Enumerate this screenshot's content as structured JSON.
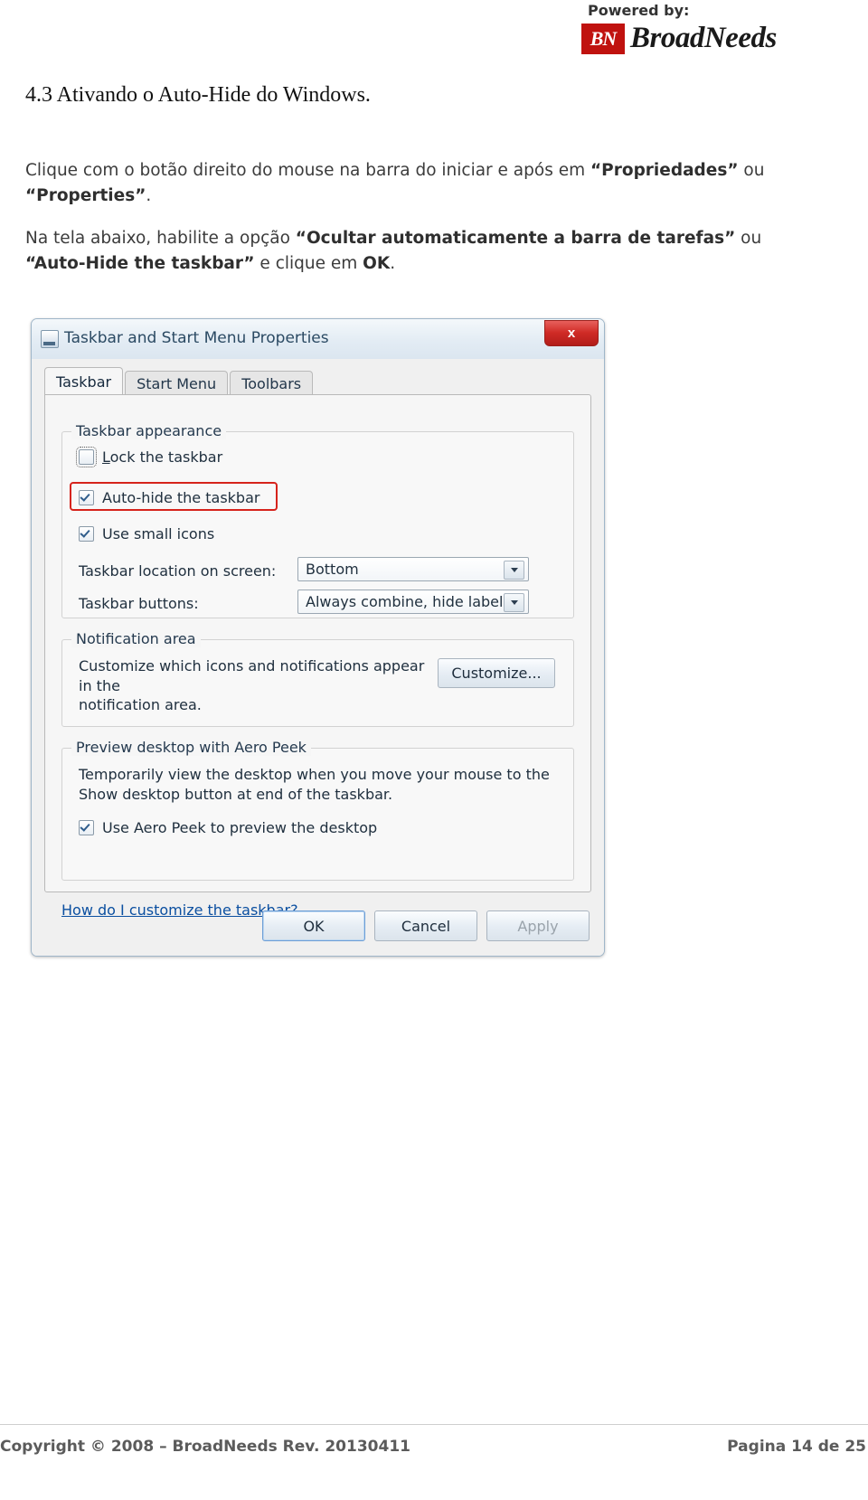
{
  "header": {
    "powered_by": "Powered by:",
    "logo_mark": "BN",
    "logo_text": "BroadNeeds"
  },
  "section": {
    "title": "4.3 Ativando o Auto-Hide do Windows."
  },
  "paragraphs": {
    "p1_a": "Clique com o botão direito do mouse na barra do iniciar e após em ",
    "p1_b": "“Propriedades”",
    "p1_c": " ou ",
    "p1_d": "“Properties”",
    "p1_e": ".",
    "p2_a": "Na tela abaixo, habilite a opção ",
    "p2_b": "“Ocultar automaticamente a barra de tarefas”",
    "p2_c": " ou ",
    "p2_d": "“Auto-Hide the taskbar”",
    "p2_e": " e clique em ",
    "p2_f": "OK",
    "p2_g": "."
  },
  "dialog": {
    "title": "Taskbar and Start Menu Properties",
    "close_label": "x",
    "tabs": [
      {
        "label": "Taskbar",
        "active": true
      },
      {
        "label": "Start Menu",
        "active": false
      },
      {
        "label": "Toolbars",
        "active": false
      }
    ],
    "taskbar_appearance": {
      "legend": "Taskbar appearance",
      "lock_taskbar": "Lock the taskbar",
      "auto_hide": "Auto-hide the taskbar",
      "small_icons": "Use small icons",
      "location_label": "Taskbar location on screen:",
      "location_value": "Bottom",
      "buttons_label": "Taskbar buttons:",
      "buttons_value": "Always combine, hide labels"
    },
    "notification_area": {
      "legend": "Notification area",
      "description_line1": "Customize which icons and notifications appear in the",
      "description_line2": "notification area.",
      "customize_button": "Customize..."
    },
    "aero_peek": {
      "legend": "Preview desktop with Aero Peek",
      "description_line1": "Temporarily view the desktop when you move your mouse to the",
      "description_line2": "Show desktop button at end of the taskbar.",
      "checkbox": "Use Aero Peek to preview the desktop"
    },
    "help_link": "How do I customize the taskbar?",
    "buttons": {
      "ok": "OK",
      "cancel": "Cancel",
      "apply": "Apply"
    }
  },
  "footer": {
    "left": "Copyright © 2008 – BroadNeeds  Rev. 20130411",
    "right": "Pagina 14 de 25"
  },
  "colors": {
    "brand_red": "#c0120f",
    "highlight_red": "#d6231c",
    "link_blue": "#0b4fa0",
    "footer_gray": "#5b5b5b"
  }
}
